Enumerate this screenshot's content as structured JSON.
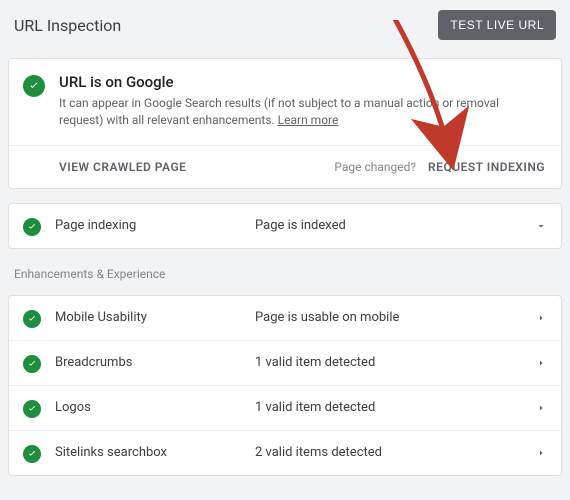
{
  "header": {
    "title": "URL Inspection",
    "test_live_url": "TEST LIVE URL"
  },
  "status": {
    "title": "URL is on Google",
    "description_prefix": "It can appear in Google Search results (if not subject to a manual action or removal request) with all relevant enhancements. ",
    "learn_more": "Learn more"
  },
  "actions": {
    "view_crawled": "VIEW CRAWLED PAGE",
    "page_changed": "Page changed?",
    "request_indexing": "REQUEST INDEXING"
  },
  "indexing": {
    "label": "Page indexing",
    "value": "Page is indexed"
  },
  "enhancements_header": "Enhancements & Experience",
  "enhancements": [
    {
      "label": "Mobile Usability",
      "value": "Page is usable on mobile"
    },
    {
      "label": "Breadcrumbs",
      "value": "1 valid item detected"
    },
    {
      "label": "Logos",
      "value": "1 valid item detected"
    },
    {
      "label": "Sitelinks searchbox",
      "value": "2 valid items detected"
    }
  ]
}
